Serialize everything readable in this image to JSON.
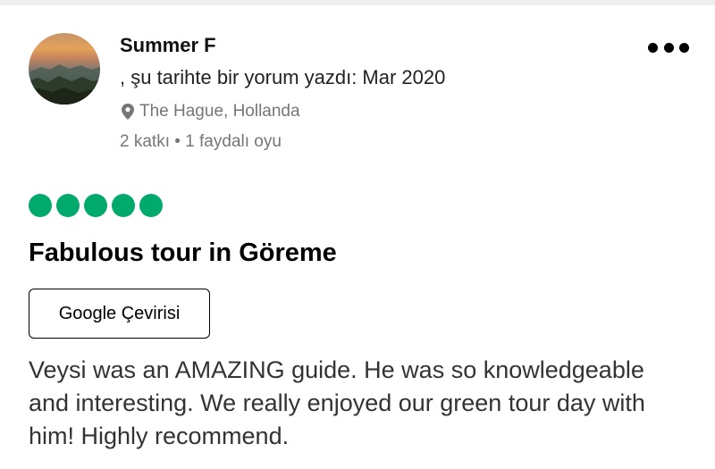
{
  "review": {
    "user": {
      "name": "Summer F",
      "wrote_line": ", şu tarihte bir yorum yazdı: Mar 2020",
      "location": "The Hague, Hollanda",
      "stats": "2 katkı • 1 faydalı oyu"
    },
    "rating": {
      "value": 5,
      "max": 5,
      "color": "#00aa6c"
    },
    "title": "Fabulous tour in Göreme",
    "translate_button": "Google Çevirisi",
    "body": "Veysi was an AMAZING guide. He was so knowledgeable and interesting. We really enjoyed our green tour day with him! Highly recommend."
  },
  "icons": {
    "more": "more-options-icon",
    "location": "map-pin-icon"
  }
}
